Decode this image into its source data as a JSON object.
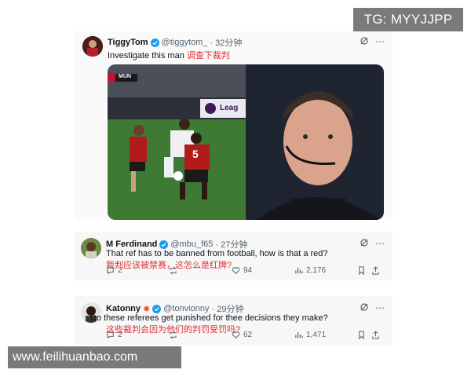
{
  "watermarks": {
    "top_right": "TG: MYYJJPP",
    "bottom_left": "www.feilihuanbao.com"
  },
  "main_tweet": {
    "name": "TiggyTom",
    "handle": "@tiggytom_",
    "time": "· 32分钟",
    "text": "Investigate this man",
    "text_zh": "调查下裁判",
    "scoreboard": "MUN",
    "board_text": "Leag",
    "player_number": "5"
  },
  "replies": [
    {
      "name": "M Ferdinand",
      "handle": "@mbu_f65",
      "time": "· 27分钟",
      "text": "That ref has to be banned from football, how is that a red?",
      "text_zh": "裁判应该被禁赛，这怎么是红牌?",
      "replies": "2",
      "retweets": "",
      "likes": "94",
      "views": "2,176"
    },
    {
      "name": "Katonny",
      "handle": "@tonvionny",
      "time": "· 29分钟",
      "text": "Do these referees get punished for thee decisions they make?",
      "text_zh": "这些裁判会因为他们的判罚受罚吗?",
      "replies": "2",
      "retweets": "",
      "likes": "62",
      "views": "1,471"
    }
  ],
  "colors": {
    "verified": "#1d9bf0",
    "translation": "#e0303a",
    "muted": "#536471"
  }
}
